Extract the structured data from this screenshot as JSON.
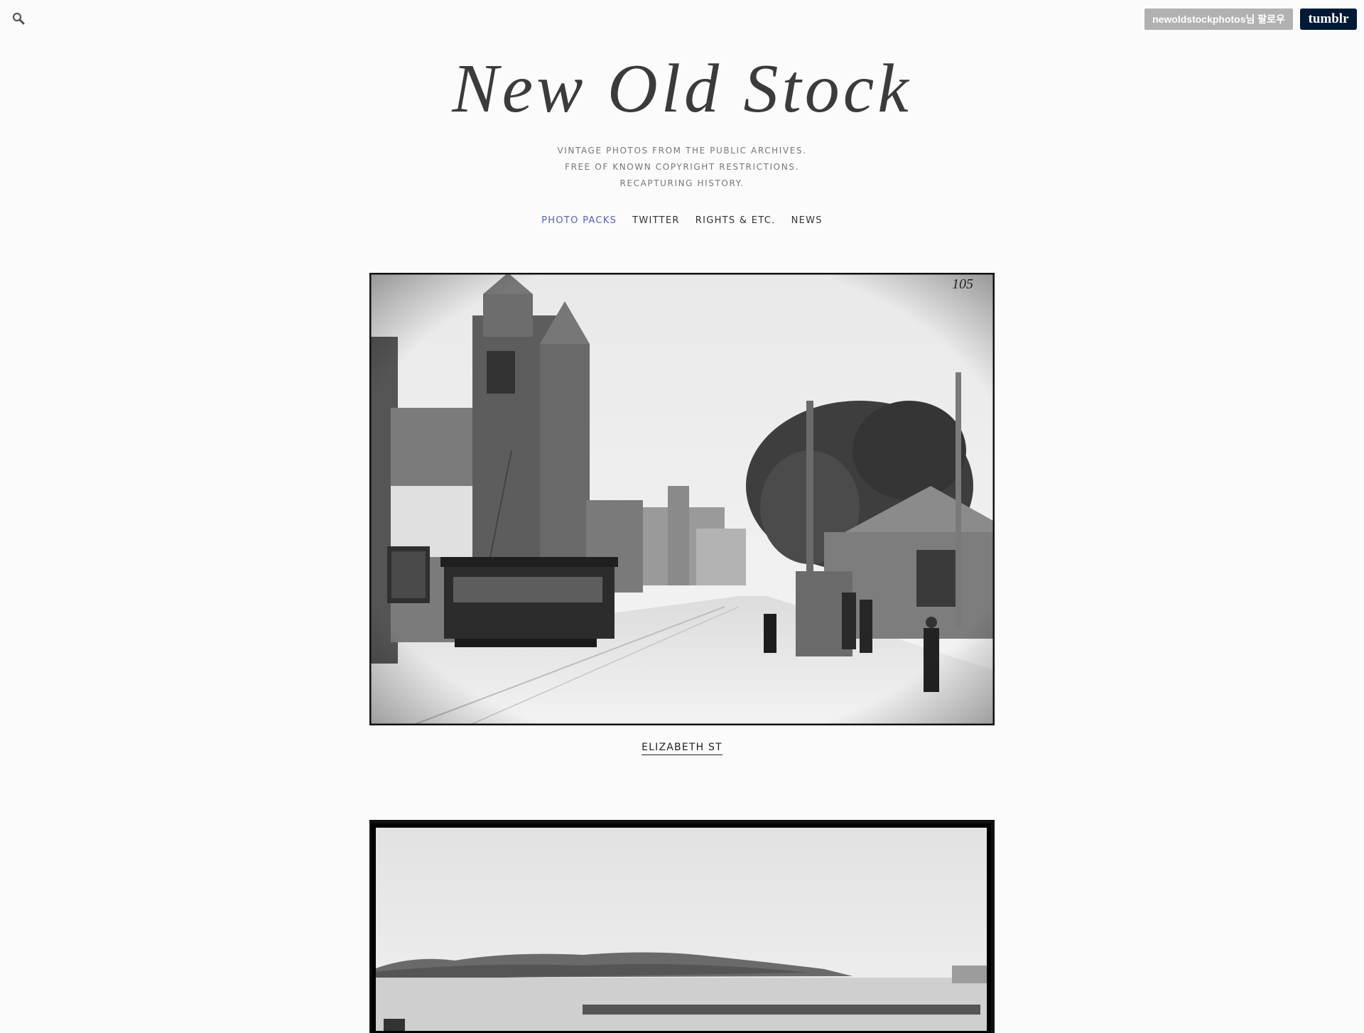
{
  "header": {
    "follow_label": "newoldstockphotos님 팔로우",
    "tumblr_label": "tumblr"
  },
  "blog": {
    "title": "New Old Stock",
    "tagline": [
      "VINTAGE PHOTOS FROM THE PUBLIC ARCHIVES.",
      "FREE OF KNOWN COPYRIGHT RESTRICTIONS.",
      "RECAPTURING HISTORY."
    ]
  },
  "nav": {
    "items": [
      {
        "label": "PHOTO PACKS",
        "active": true
      },
      {
        "label": "TWITTER",
        "active": false
      },
      {
        "label": "RIGHTS & ETC.",
        "active": false
      },
      {
        "label": "NEWS",
        "active": false
      }
    ]
  },
  "posts": [
    {
      "caption": "ELIZABETH ST",
      "plate_number": "105"
    },
    {
      "caption": ""
    }
  ],
  "colors": {
    "background": "#fbfbfb",
    "active_nav": "#5560c8",
    "follow_button": "#b1b1b1",
    "tumblr_button": "#001935"
  },
  "icons": {
    "search": "search-icon"
  }
}
